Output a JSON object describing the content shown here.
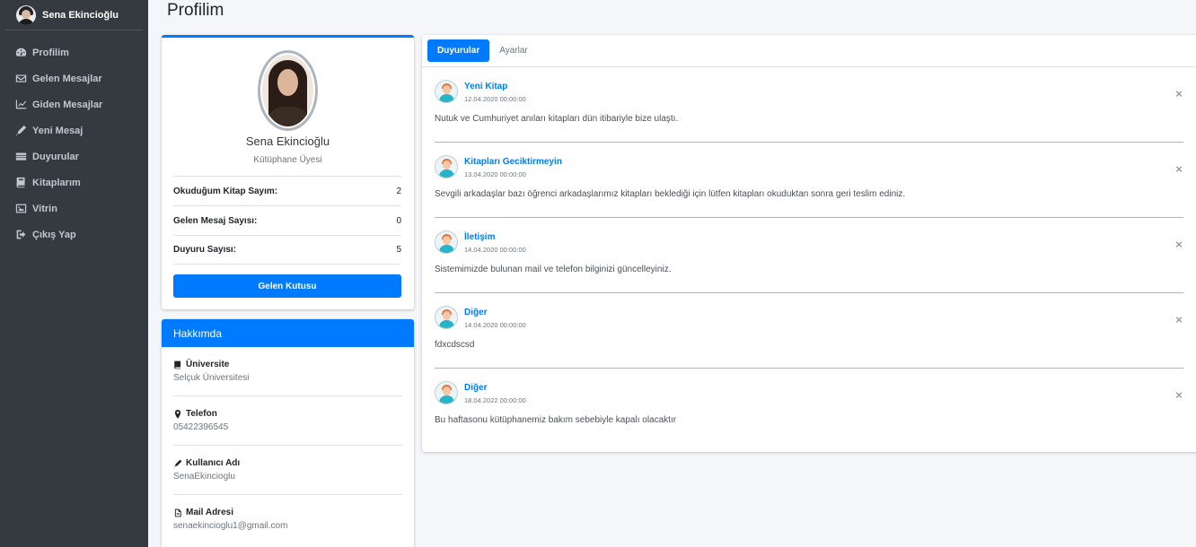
{
  "user": {
    "name": "Sena Ekincioğlu"
  },
  "sidebar": {
    "items": [
      {
        "label": "Profilim",
        "icon": "dashboard-icon"
      },
      {
        "label": "Gelen Mesajlar",
        "icon": "envelope-icon"
      },
      {
        "label": "Giden Mesajlar",
        "icon": "chart-line-icon"
      },
      {
        "label": "Yeni Mesaj",
        "icon": "pen-icon"
      },
      {
        "label": "Duyurular",
        "icon": "list-icon"
      },
      {
        "label": "Kitaplarım",
        "icon": "book-icon"
      },
      {
        "label": "Vitrin",
        "icon": "image-icon"
      },
      {
        "label": "Çıkış Yap",
        "icon": "sign-out-icon"
      }
    ]
  },
  "page": {
    "title": "Profilim"
  },
  "profile": {
    "name": "Sena Ekincioğlu",
    "role": "Kütüphane Üyesi",
    "stats": [
      {
        "label": "Okuduğum Kitap Sayım:",
        "value": "2"
      },
      {
        "label": "Gelen Mesaj Sayısı:",
        "value": "0"
      },
      {
        "label": "Duyuru Sayısı:",
        "value": "5"
      }
    ],
    "inbox_button": "Gelen Kutusu"
  },
  "about": {
    "title": "Hakkımda",
    "items": [
      {
        "label": "Üniversite",
        "value": "Selçuk Üniversitesi",
        "icon": "book-icon"
      },
      {
        "label": "Telefon",
        "value": "05422396545",
        "icon": "map-marker-icon"
      },
      {
        "label": "Kullanıcı Adı",
        "value": "SenaEkincioglu",
        "icon": "pencil-icon"
      },
      {
        "label": "Mail Adresi",
        "value": "senaekincioglu1@gmail.com",
        "icon": "file-icon"
      }
    ]
  },
  "tabs": [
    {
      "label": "Duyurular",
      "active": true
    },
    {
      "label": "Ayarlar",
      "active": false
    }
  ],
  "announcements": [
    {
      "title": "Yeni Kitap",
      "date": "12.04.2020 00:00:00",
      "text": "Nutuk ve Cumhuriyet anıları kitapları dün itibariyle bize ulaştı."
    },
    {
      "title": "Kitapları Geciktirmeyin",
      "date": "13.04.2020 00:00:00",
      "text": "Sevgili arkadaşlar bazı öğrenci arkadaşlarımız kitapları beklediği için lütfen kitapları okuduktan sonra geri teslim ediniz."
    },
    {
      "title": "İletişim",
      "date": "14.04.2020 00:00:00",
      "text": "Sistemimizde bulunan mail ve telefon bilginizi güncelleyiniz."
    },
    {
      "title": "Diğer",
      "date": "14.04.2020 00:00:00",
      "text": "fdxcdscsd"
    },
    {
      "title": "Diğer",
      "date": "18.04.2022 00:00:00",
      "text": "Bu haftasonu kütüphanemiz bakım sebebiyle kapalı olacaktır"
    }
  ],
  "close_symbol": "×",
  "colors": {
    "sidebar": "#343a40",
    "accent": "#007bff"
  }
}
